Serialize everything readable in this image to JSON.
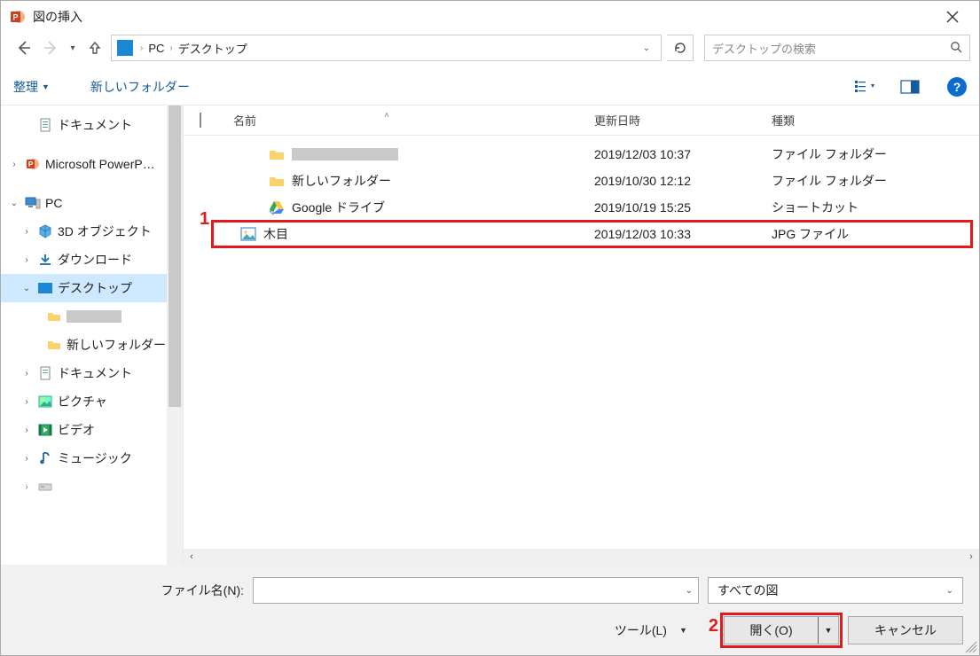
{
  "window": {
    "title": "図の挿入",
    "close_label": "×"
  },
  "breadcrumb": {
    "seg1": "PC",
    "seg2": "デスクトップ"
  },
  "search": {
    "placeholder": "デスクトップの検索"
  },
  "toolbar": {
    "organize": "整理",
    "new_folder": "新しいフォルダー"
  },
  "tree": {
    "documents": "ドキュメント",
    "powerpoint": "Microsoft PowerP…",
    "pc": "PC",
    "objects3d": "3D オブジェクト",
    "downloads": "ダウンロード",
    "desktop": "デスクトップ",
    "new_folder": "新しいフォルダー",
    "documents2": "ドキュメント",
    "pictures": "ピクチャ",
    "videos": "ビデオ",
    "music": "ミュージック"
  },
  "columns": {
    "name": "名前",
    "date": "更新日時",
    "type": "種類"
  },
  "files": [
    {
      "name": "",
      "date": "2019/12/03 10:37",
      "type": "ファイル フォルダー",
      "icon": "folder",
      "redacted": true
    },
    {
      "name": "新しいフォルダー",
      "date": "2019/10/30 12:12",
      "type": "ファイル フォルダー",
      "icon": "folder",
      "redacted": false
    },
    {
      "name": "Google ドライブ",
      "date": "2019/10/19 15:25",
      "type": "ショートカット",
      "icon": "gdrive",
      "redacted": false
    },
    {
      "name": "木目",
      "date": "2019/12/03 10:33",
      "type": "JPG ファイル",
      "icon": "image",
      "redacted": false
    }
  ],
  "footer": {
    "filename_label": "ファイル名(N):",
    "filename_value": "",
    "filetype_label": "すべての図",
    "tools_label": "ツール(L)",
    "open_label": "開く(O)",
    "cancel_label": "キャンセル"
  },
  "annotations": {
    "one": "1",
    "two": "2"
  }
}
